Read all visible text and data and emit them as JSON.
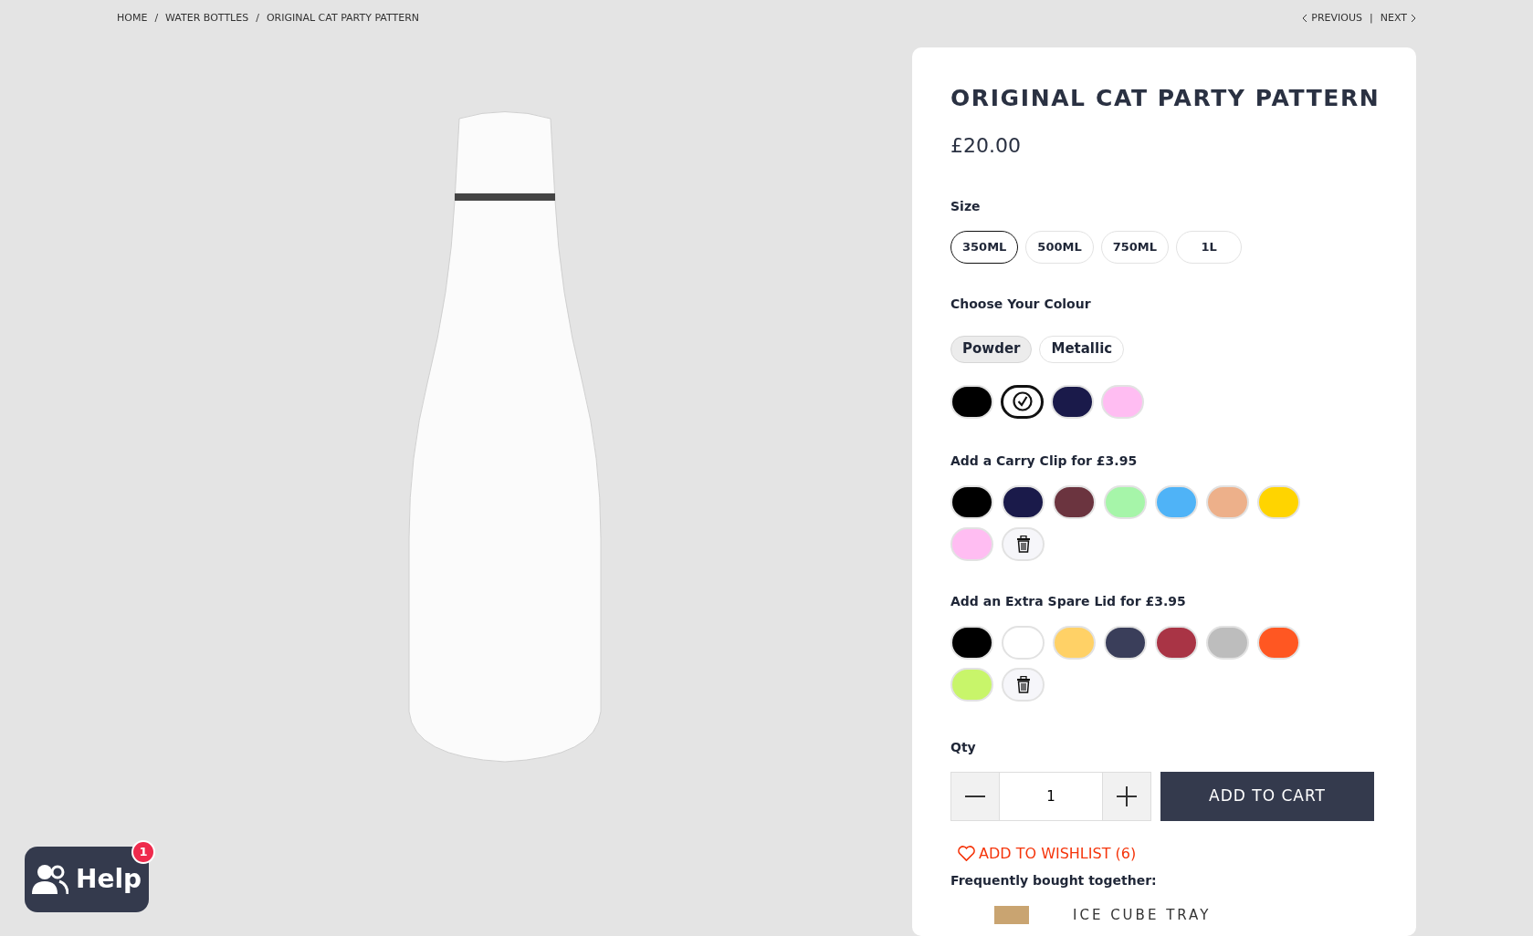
{
  "breadcrumb": [
    {
      "label": "HOME"
    },
    {
      "separator": "/",
      "label": "WATER BOTTLES"
    },
    {
      "separator": "/",
      "label": "ORIGINAL CAT PARTY PATTERN"
    }
  ],
  "pager": {
    "previous": "PREVIOUS",
    "separator": "|",
    "next": "NEXT"
  },
  "product": {
    "title": "ORIGINAL CAT PARTY PATTERN",
    "price": "£20.00",
    "size": {
      "label": "Size",
      "options": [
        {
          "label": "350ML",
          "selected": true
        },
        {
          "label": "500ML",
          "selected": false
        },
        {
          "label": "750ML",
          "selected": false
        },
        {
          "label": "1L",
          "selected": false
        }
      ]
    },
    "colour": {
      "label": "Choose Your Colour",
      "finishes": [
        {
          "label": "Powder",
          "selected": true
        },
        {
          "label": "Metallic",
          "selected": false
        }
      ],
      "swatches": [
        {
          "color": "#000000",
          "selected": false
        },
        {
          "color": "#ffffff",
          "selected": true
        },
        {
          "color": "#1a1a4a",
          "selected": false
        },
        {
          "color": "#ffbdf2",
          "selected": false
        }
      ]
    },
    "carry_clip": {
      "label": "Add a Carry Clip for £3.95",
      "swatches": [
        {
          "color": "#000000",
          "selected": false
        },
        {
          "color": "#1a1a4a",
          "selected": false
        },
        {
          "color": "#6b343f",
          "selected": false
        },
        {
          "color": "#a6f5a9",
          "selected": false
        },
        {
          "color": "#4fb3f7",
          "selected": false
        },
        {
          "color": "#edb08a",
          "selected": false
        },
        {
          "color": "#ffd400",
          "selected": false
        },
        {
          "color": "#ffbdf2",
          "selected": false
        }
      ]
    },
    "spare_lid": {
      "label": "Add an Extra Spare Lid for £3.95",
      "swatches": [
        {
          "color": "#000000",
          "selected": false
        },
        {
          "color": "#ffffff",
          "selected": false
        },
        {
          "color": "#ffd166",
          "selected": false
        },
        {
          "color": "#3a3e5a",
          "selected": false
        },
        {
          "color": "#a93445",
          "selected": false
        },
        {
          "color": "#bdbdbd",
          "selected": false
        },
        {
          "color": "#ff5722",
          "selected": false
        },
        {
          "color": "#c8f56a",
          "selected": false
        }
      ]
    },
    "qty": {
      "label": "Qty",
      "value": "1"
    },
    "add_to_cart": "ADD TO CART",
    "wishlist": "ADD TO WISHLIST (6)",
    "frequently_bought": {
      "label": "Frequently bought together:",
      "items": [
        {
          "name": "ICE CUBE TRAY"
        }
      ]
    }
  },
  "help": {
    "label": "Help",
    "badge": "1"
  }
}
